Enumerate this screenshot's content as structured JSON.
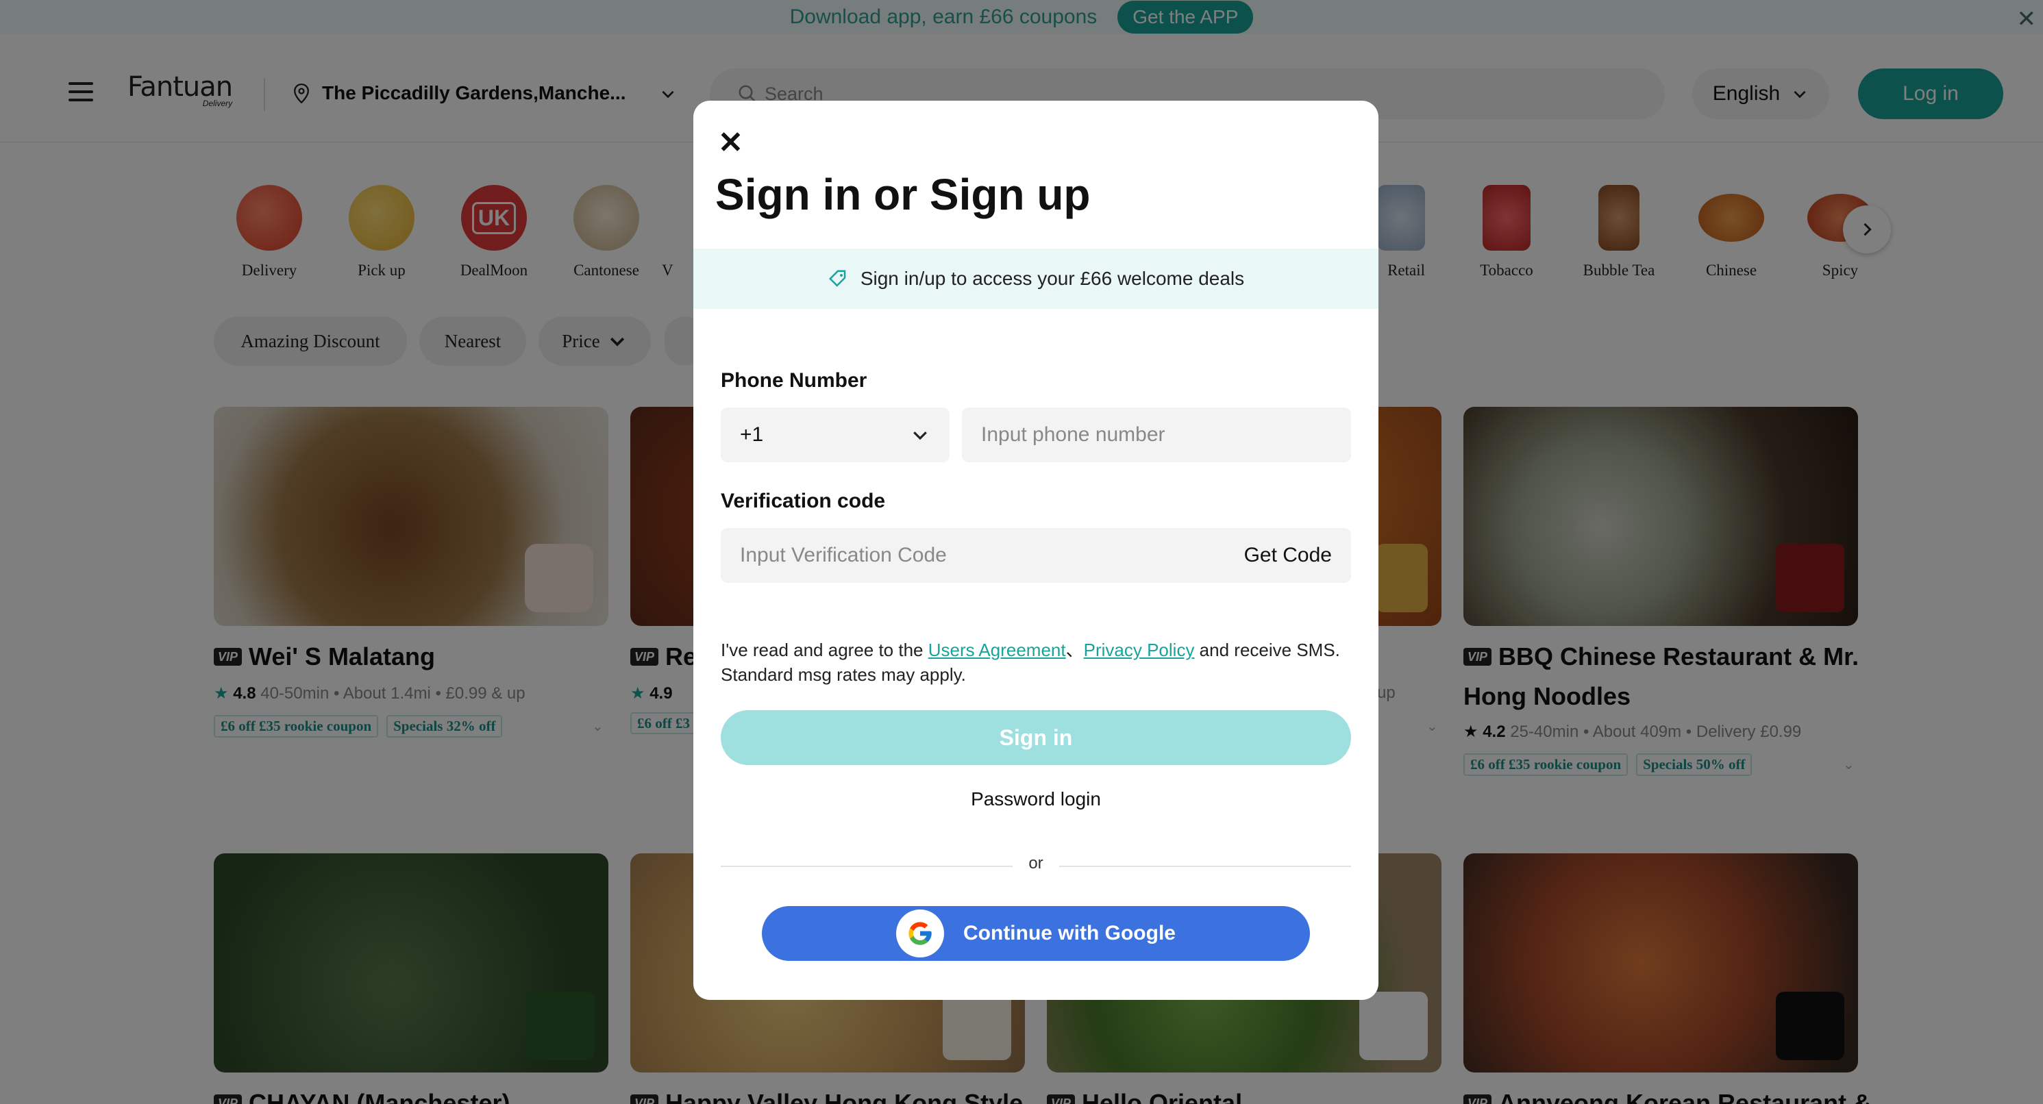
{
  "banner": {
    "text": "Download app, earn £66 coupons",
    "button": "Get the APP"
  },
  "header": {
    "logo": "Fantuan",
    "logo_sub": "Delivery",
    "location": "The Piccadilly Gardens,Manche...",
    "search_placeholder": "Search",
    "language": "English",
    "login": "Log in"
  },
  "categories": [
    {
      "label": "Delivery",
      "color": "#f0503c"
    },
    {
      "label": "Pick up",
      "color": "#f3c33b"
    },
    {
      "label": "DealMoon",
      "color": "#e23b3b",
      "badge": "UK"
    },
    {
      "label": "Cantonese",
      "color": "#e8d7b8"
    },
    {
      "label": "V"
    },
    {
      "label": "Retail"
    },
    {
      "label": "Tobacco",
      "color": "#d43b3b"
    },
    {
      "label": "Bubble Tea",
      "color": "#b5703d"
    },
    {
      "label": "Chinese",
      "color": "#e0702a"
    },
    {
      "label": "Spicy",
      "color": "#d94a2a"
    }
  ],
  "filters": [
    "Amazing Discount",
    "Nearest",
    "Price"
  ],
  "cards": [
    {
      "title": "Wei' S Malatang",
      "rating": "4.8",
      "meta": "40-50min • About 1.4mi • £0.99 & up",
      "coupons": [
        "£6 off £35 rookie coupon",
        "Specials 32% off"
      ],
      "img_color": "#8a6a4a"
    },
    {
      "title": "Re",
      "rating": "4.9",
      "coupons": [
        "£6 off £3"
      ],
      "img_color": "#7a3a22"
    },
    {
      "meta_tail": "up",
      "img_color": "#b86a2a"
    },
    {
      "title_line1": "BBQ Chinese Restaurant & Mr.",
      "title_line2": "Hong Noodles",
      "rating": "4.2",
      "meta": "25-40min • About 409m • Delivery £0.99",
      "coupons": [
        "£6 off £35 rookie coupon",
        "Specials 50% off"
      ],
      "img_color": "#4a3a2a"
    }
  ],
  "cards_row2": [
    {
      "title": "CHAYAN (Manchester)",
      "img_color": "#3f5a3a"
    },
    {
      "title": "Happy Valley Hong Kong Style",
      "img_color": "#c89a5a"
    },
    {
      "title": "Hello Oriental",
      "img_color": "#6a8a3a"
    },
    {
      "title": "Annyeong Korean Restaurant &",
      "img_color": "#a85a3a"
    }
  ],
  "vip_label": "VIP",
  "modal": {
    "title": "Sign in or Sign up",
    "promo": "Sign in/up to access your £66 welcome deals",
    "phone_label": "Phone Number",
    "country_code": "+1",
    "phone_placeholder": "Input phone number",
    "code_label": "Verification code",
    "code_placeholder": "Input Verification Code",
    "get_code": "Get Code",
    "agree_pre": "I've read and agree to the ",
    "users_agreement": "Users Agreement",
    "sep": "、",
    "privacy_policy": "Privacy Policy",
    "agree_post": " and receive SMS. Standard msg rates may apply.",
    "signin": "Sign in",
    "password_login": "Password login",
    "or": "or",
    "google": "Continue with Google"
  },
  "colors": {
    "accent": "#1aa39b",
    "google_blue": "#3b72e0",
    "signin_disabled": "#9edfdf"
  }
}
